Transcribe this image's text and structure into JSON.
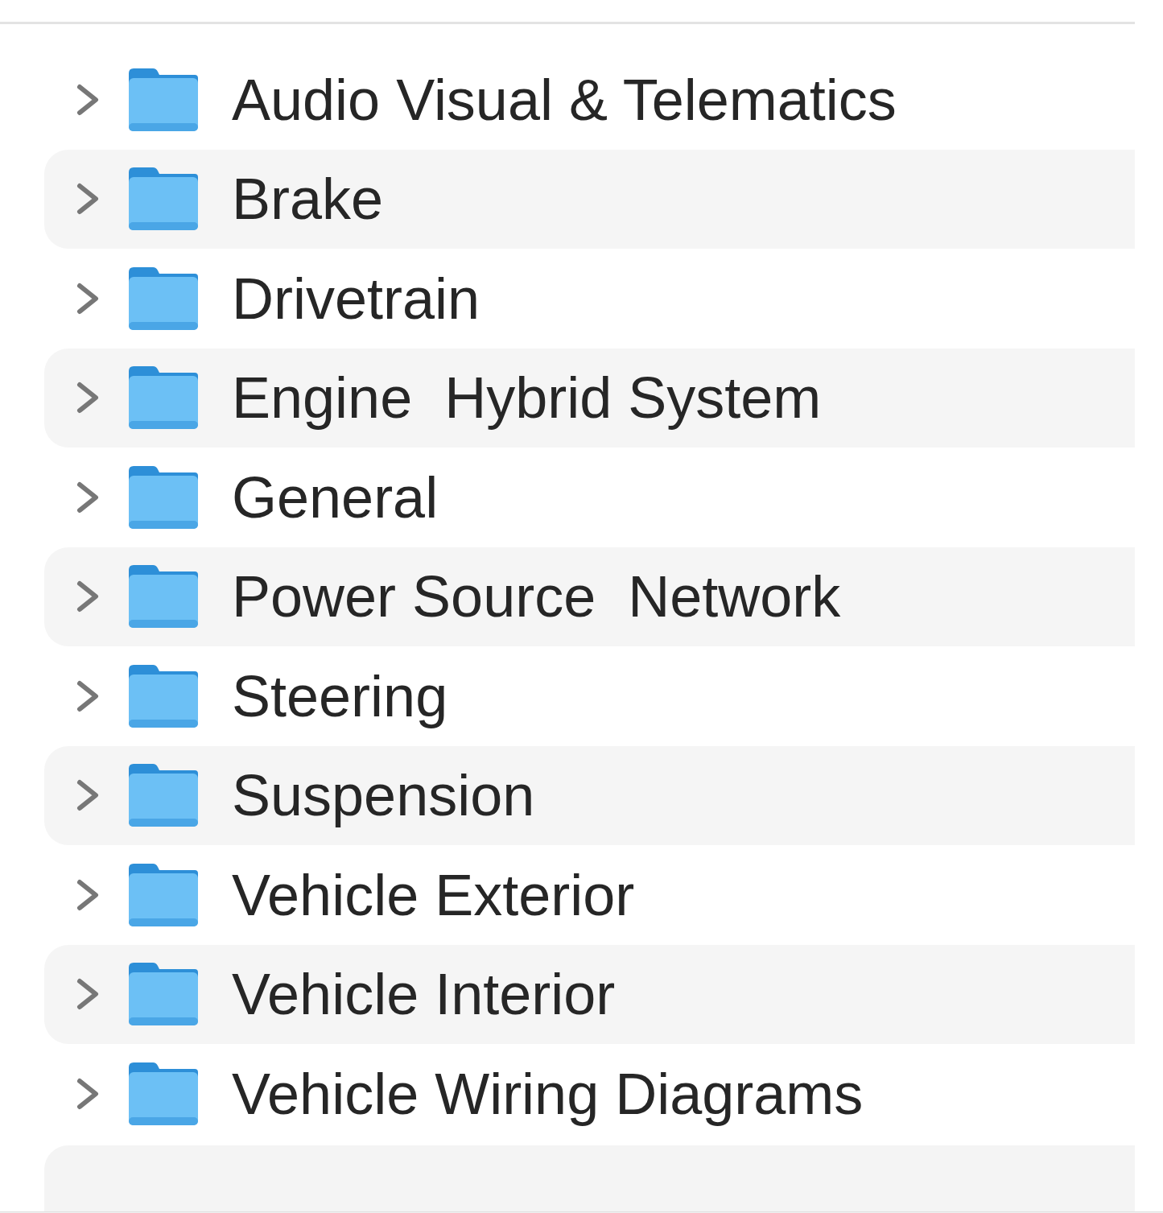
{
  "folders": [
    {
      "name": "Audio Visual & Telematics",
      "expanded": false
    },
    {
      "name": "Brake",
      "expanded": false
    },
    {
      "name": "Drivetrain",
      "expanded": false
    },
    {
      "name": "Engine  Hybrid System",
      "expanded": false
    },
    {
      "name": "General",
      "expanded": false
    },
    {
      "name": "Power Source  Network",
      "expanded": false
    },
    {
      "name": "Steering",
      "expanded": false
    },
    {
      "name": "Suspension",
      "expanded": false
    },
    {
      "name": "Vehicle Exterior",
      "expanded": false
    },
    {
      "name": "Vehicle Interior",
      "expanded": false
    },
    {
      "name": "Vehicle Wiring Diagrams",
      "expanded": false
    }
  ]
}
